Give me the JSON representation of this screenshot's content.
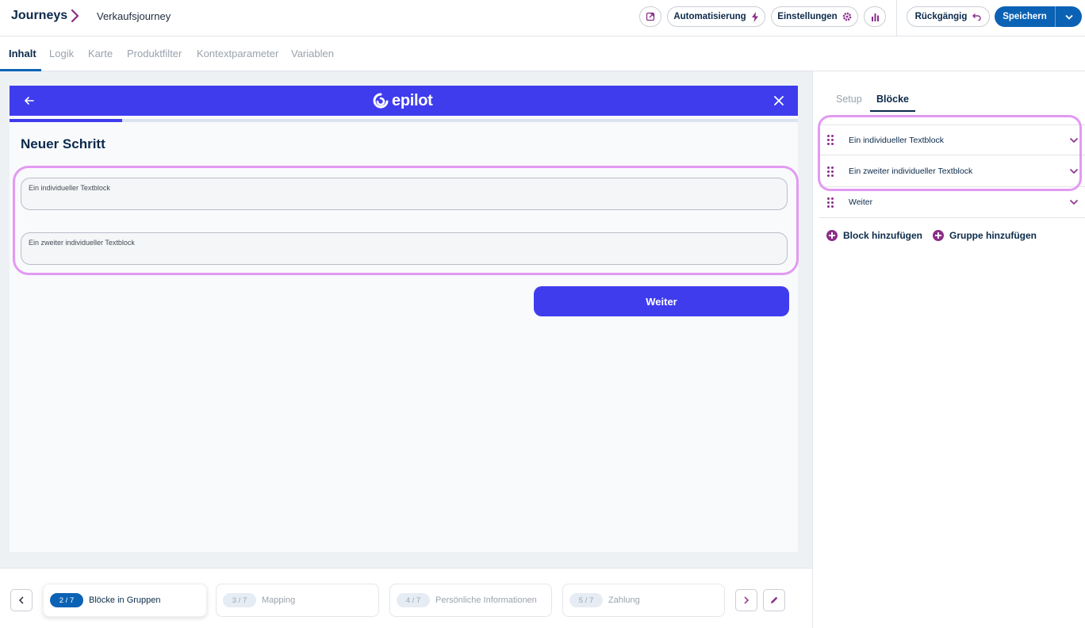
{
  "header": {
    "app_title": "Journeys",
    "journey_name": "Verkaufsjourney",
    "buttons": {
      "automation": "Automatisierung",
      "settings": "Einstellungen",
      "undo": "Rückgängig",
      "save": "Speichern"
    },
    "icons": [
      "external-link-icon",
      "lightning-icon",
      "gear-icon",
      "bar-chart-icon",
      "undo-icon",
      "chevron-down-icon"
    ]
  },
  "tabs": [
    "Inhalt",
    "Logik",
    "Karte",
    "Produktfilter",
    "Kontextparameter",
    "Variablen"
  ],
  "preview": {
    "logo_text": "epilot",
    "step_title": "Neuer Schritt",
    "fields": [
      {
        "label": "Ein individueller Textblock"
      },
      {
        "label": "Ein zweiter individueller Textblock"
      }
    ],
    "next_button": "Weiter",
    "progress": 0.143,
    "colors": {
      "brand": "#3f3cee",
      "highlight": "#e29af2"
    }
  },
  "right_panel": {
    "tabs": [
      "Setup",
      "Blöcke"
    ],
    "blocks": [
      {
        "label": "Ein individueller Textblock"
      },
      {
        "label": "Ein zweiter individueller Textblock"
      },
      {
        "label": "Weiter"
      }
    ],
    "add_block": "Block hinzufügen",
    "add_group": "Gruppe hinzufügen"
  },
  "footer": {
    "steps": [
      {
        "pill": "2 / 7",
        "name": "Blöcke in Gruppen"
      },
      {
        "pill": "3 / 7",
        "name": "Mapping"
      },
      {
        "pill": "4 / 7",
        "name": "Persönliche Informationen"
      },
      {
        "pill": "5 / 7",
        "name": "Zahlung"
      }
    ]
  }
}
